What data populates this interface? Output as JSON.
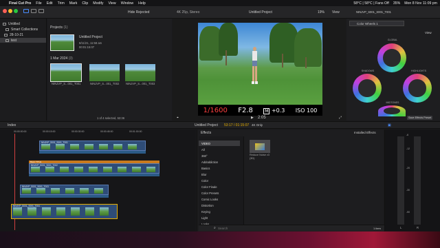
{
  "menubar": {
    "app": "Final Cut Pro",
    "items": [
      "File",
      "Edit",
      "Trim",
      "Mark",
      "Clip",
      "Modify",
      "View",
      "Window",
      "Help"
    ],
    "status_temp": "58°C | 58°C | Fans Off",
    "battery": "35%",
    "clock": "Mon 8 Nov 11:09 pm"
  },
  "toolbar": {
    "hide_rejected": "Hide Rejected",
    "format": "4K 25p, Stereo",
    "project_title": "Untitled Project",
    "zoom": "19%",
    "view": "View",
    "clip_name": "NINJVP_S001_S001_T001",
    "effect_selector": "Color Wheels 1"
  },
  "sidebar": {
    "items": [
      {
        "label": "Untitled",
        "type": "library"
      },
      {
        "label": "Smart Collections",
        "type": "folder"
      },
      {
        "label": "28-10-21",
        "type": "event"
      },
      {
        "label": "test",
        "type": "event",
        "selected": true
      }
    ]
  },
  "browser": {
    "projects_header": "Projects",
    "projects_count": "(1)",
    "project": {
      "name": "Untitled Project",
      "date": "8/11/21, 11:58 am",
      "duration": "00:01:15:07"
    },
    "date_header": "1 Mar 2024",
    "date_count": "(3)",
    "clips": [
      {
        "label": "NINJVP_S...001_T001"
      },
      {
        "label": "NINJVP_S...001_T002"
      },
      {
        "label": "NINJVP_S...001_T003"
      }
    ],
    "status": "1 of 4 selected, 53:36"
  },
  "viewer": {
    "shutter": "1/1600",
    "fstop": "F2.8",
    "ev": "+0.3",
    "iso": "ISO 100",
    "timecode": "2:05"
  },
  "inspector": {
    "view_button": "View",
    "wheels": [
      "GLOBAL",
      "SHADOWS",
      "HIGHLIGHTS",
      "MIDTONES"
    ],
    "save_preset": "Save Effects Preset"
  },
  "timeline": {
    "index_label": "Index",
    "project_label": "Untitled Project",
    "duration": "53:17 / 01:15:07",
    "ruler": [
      "00:00:00:00",
      "00:00:15:00",
      "00:00:30:00",
      "00:00:45:00",
      "00:01:00:00"
    ],
    "clips": [
      {
        "label": "NINJVP_S001_S001_T001"
      },
      {
        "label": "Basic TITLE"
      },
      {
        "label": "NINJVP_S001_S001_T002"
      },
      {
        "label": "NINJVP_S001_S001_T003"
      },
      {
        "label": "NINJVP_S001_S001_T004"
      }
    ]
  },
  "effects": {
    "header": "Effects",
    "filter": "4K Only",
    "installed": "Installed Effects",
    "categories": [
      "VIDEO",
      "All",
      "360°",
      "Addoddiction",
      "Basics",
      "Blur",
      "Color",
      "Color Finale",
      "Color Presets",
      "Comic Looks",
      "Distortion",
      "Keying",
      "Light",
      "Looks"
    ],
    "selected_category": "VIDEO",
    "effect_item": {
      "name": "Reduce Noise v3",
      "sub": "(3D)"
    },
    "search_placeholder": "Search",
    "item_count": "1 item"
  },
  "meters": {
    "scale": [
      "-6",
      "-12",
      "-20",
      "-30",
      "-50"
    ],
    "left": "L",
    "right": "R"
  },
  "colors": {
    "accent": "#e8b000",
    "clip_blue": "#2e4c77",
    "title_orange": "#c97a1e"
  }
}
